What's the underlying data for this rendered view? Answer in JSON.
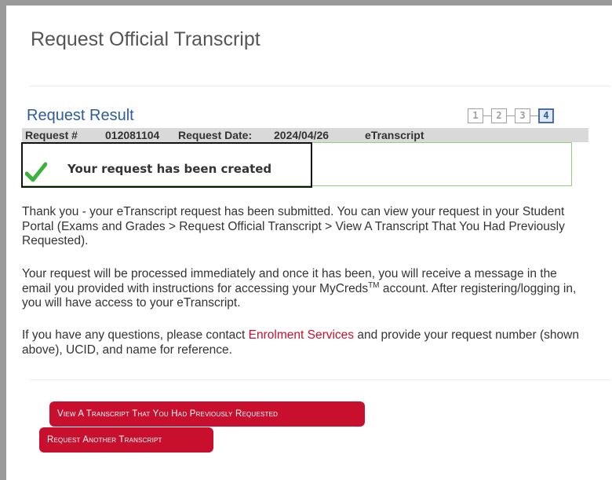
{
  "page": {
    "title": "Request Official Transcript"
  },
  "result": {
    "section_title": "Request Result",
    "steps": [
      "1",
      "2",
      "3",
      "4"
    ],
    "active_step": 4,
    "info": {
      "request_label": "Request #",
      "request_number": "012081104",
      "date_label": "Request Date:",
      "date_value": "2024/04/26",
      "type": "eTranscript"
    },
    "message": "Your request has been created",
    "success_color": "#3bb33b"
  },
  "paragraphs": {
    "p1": "Thank you - your eTranscript request has been submitted. You can view your request in your Student Portal (Exams and Grades > Request Official Transcript > View A Transcript That You Had Previously Requested).",
    "p2_before": "Your request will be processed immediately and once it has been, you will receive a message in the email you provided with instructions for accessing your MyCreds",
    "p2_sup": "TM",
    "p2_after": " account. After registering/logging in, you will have access to your eTranscript.",
    "p3_before": "If you have any questions, please contact ",
    "p3_link": "Enrolment Services",
    "p3_after": " and provide your request number (shown above), UCID, and name for reference."
  },
  "buttons": {
    "view_previous": "View A Transcript That You Had Previously Requested",
    "request_another": "Request Another Transcript"
  },
  "colors": {
    "accent": "#c8102e",
    "heading_blue": "#2e5d99"
  }
}
